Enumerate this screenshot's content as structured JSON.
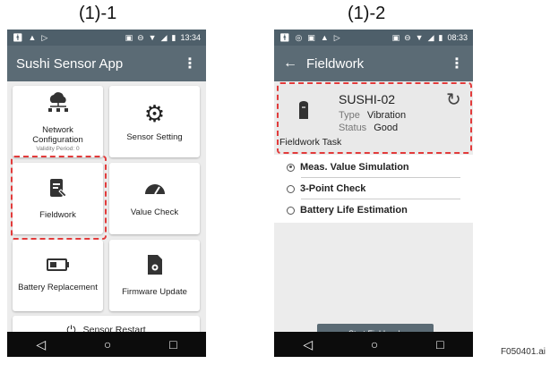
{
  "captions": {
    "left": "(1)-1",
    "right": "(1)-2"
  },
  "file_label": "F050401.ai",
  "status_bar": {
    "left_icons": [
      "person-icon",
      "warning-icon",
      "play-icon"
    ],
    "right_icons": [
      "nfc-icon",
      "do-not-disturb-icon",
      "wifi-icon",
      "signal-icon",
      "battery-icon"
    ],
    "time_left": "13:34",
    "time_right": "08:33"
  },
  "screen1": {
    "title": "Sushi Sensor App",
    "tiles": {
      "network": {
        "label_line1": "Network",
        "label_line2": "Configuration",
        "sub": "Validity Period: 0"
      },
      "sensor_setting": {
        "label": "Sensor Setting"
      },
      "fieldwork": {
        "label": "Fieldwork"
      },
      "value_check": {
        "label": "Value Check"
      },
      "battery": {
        "label": "Battery Replacement"
      },
      "firmware": {
        "label": "Firmware Update"
      },
      "restart": {
        "label": "Sensor Restart"
      }
    }
  },
  "screen2": {
    "title": "Fieldwork",
    "device": {
      "name": "SUSHI-02",
      "type_label": "Type",
      "type_value": "Vibration",
      "status_label": "Status",
      "status_value": "Good"
    },
    "section_title": "Fieldwork Task",
    "options": [
      {
        "label": "Meas. Value Simulation",
        "selected": true
      },
      {
        "label": "3-Point Check",
        "selected": false
      },
      {
        "label": "Battery Life Estimation",
        "selected": false
      }
    ],
    "start_button": "Start Fieldwork"
  },
  "colors": {
    "appbar": "#5b6b75",
    "highlight": "#e23b3b"
  }
}
